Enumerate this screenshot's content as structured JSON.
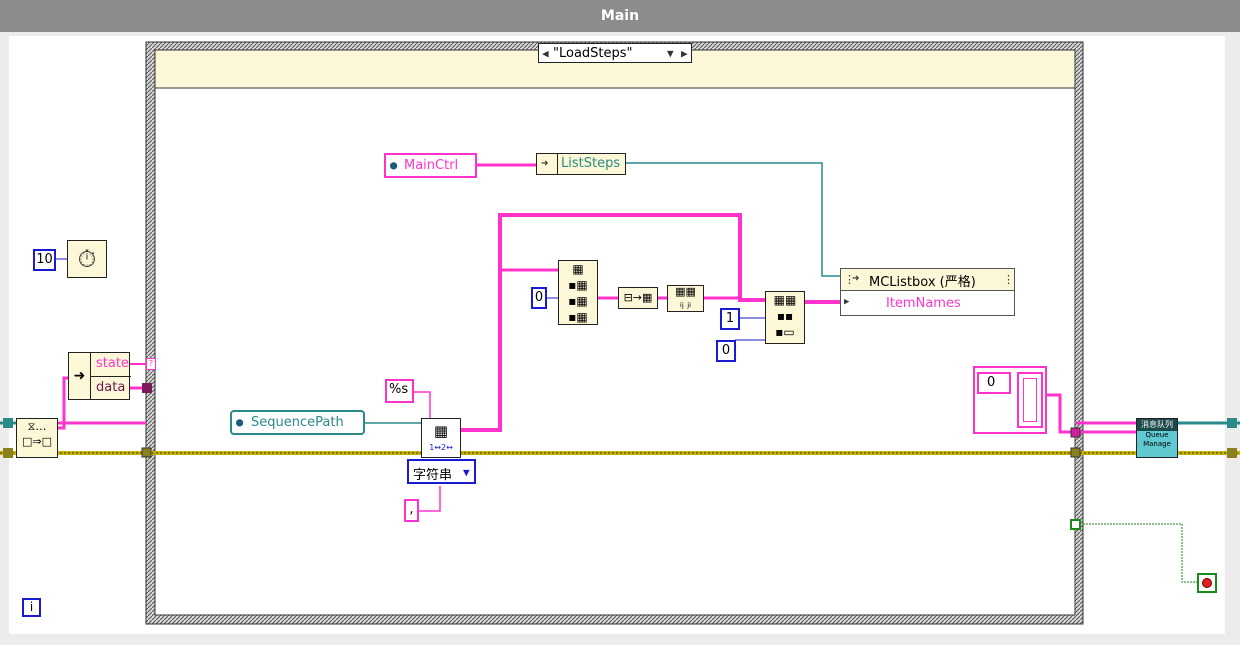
{
  "window": {
    "title": "Main"
  },
  "case_selector": {
    "value": "\"LoadSteps\""
  },
  "constants": {
    "wait_ms": "10",
    "format": "%s",
    "delimiter": ",",
    "index_zero": "0",
    "index_one": "1",
    "index_zero_b": "0",
    "array_zero": "0"
  },
  "cluster": {
    "state": "state",
    "data": "data"
  },
  "refs": {
    "main_ctrl": "MainCtrl",
    "list_steps": "ListSteps",
    "sequence_path": "SequencePath",
    "listbox": "MCListbox (严格)",
    "item_names": "ItemNames"
  },
  "enum_mode": "字符串",
  "subvi": {
    "line1": "消息队列",
    "line2": "Queue",
    "line3": "Manage"
  },
  "loop_info": "i",
  "colors": {
    "string_wire": "#ff33cc",
    "error_wire": "#c8b400",
    "ref_wire": "#2a8a8a",
    "numeric": "#1a1ad0",
    "node_fill": "#fbf7d7"
  }
}
